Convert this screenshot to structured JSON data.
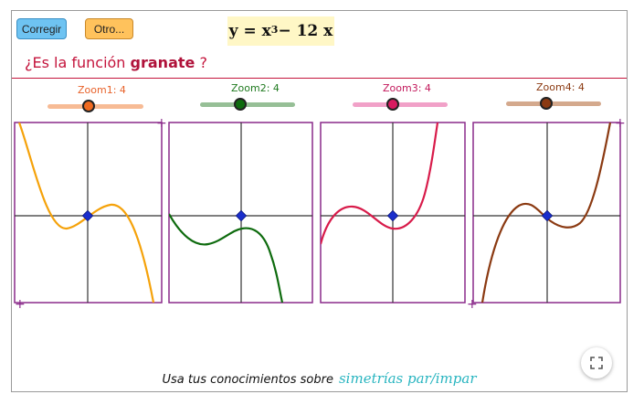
{
  "buttons": {
    "corregir": "Corregir",
    "otro": "Otro..."
  },
  "equation": {
    "lhs": "y = x",
    "exponent": "3",
    "rhs": " − 12 x"
  },
  "question": {
    "prefix": "¿Es la función ",
    "emphasis": "granate",
    "suffix": " ?"
  },
  "sliders": [
    {
      "label": "Zoom1: 4",
      "value": 4,
      "color": "#e8622a",
      "track": "#f7bb95",
      "knob": "#f06a20"
    },
    {
      "label": "Zoom2: 4",
      "value": 4,
      "color": "#1f7a1f",
      "track": "#96bf96",
      "knob": "#0e6b0e"
    },
    {
      "label": "Zoom3: 4",
      "value": 4,
      "color": "#c2185b",
      "track": "#f1a1c8",
      "knob": "#d81b60"
    },
    {
      "label": "Zoom4: 4",
      "value": 4,
      "color": "#8b3a12",
      "track": "#d4a98d",
      "knob": "#8b3a12"
    }
  ],
  "graphs": [
    {
      "curve_color": "#f5a20a",
      "transform": "-f(x)"
    },
    {
      "curve_color": "#0e6b0e",
      "transform": "-f(-x) shifted down"
    },
    {
      "curve_color": "#d81b4a",
      "transform": "f(x)"
    },
    {
      "curve_color": "#8b3a12",
      "transform": "f(x) mirrored"
    }
  ],
  "colors": {
    "frame": "#8a2a8a",
    "axis": "#333333",
    "point": "#1a2ecc"
  },
  "footer": {
    "text": "Usa tus conocimientos sobre",
    "link": "simetrías par/impar"
  },
  "icons": {
    "fullscreen": "fullscreen-icon"
  }
}
